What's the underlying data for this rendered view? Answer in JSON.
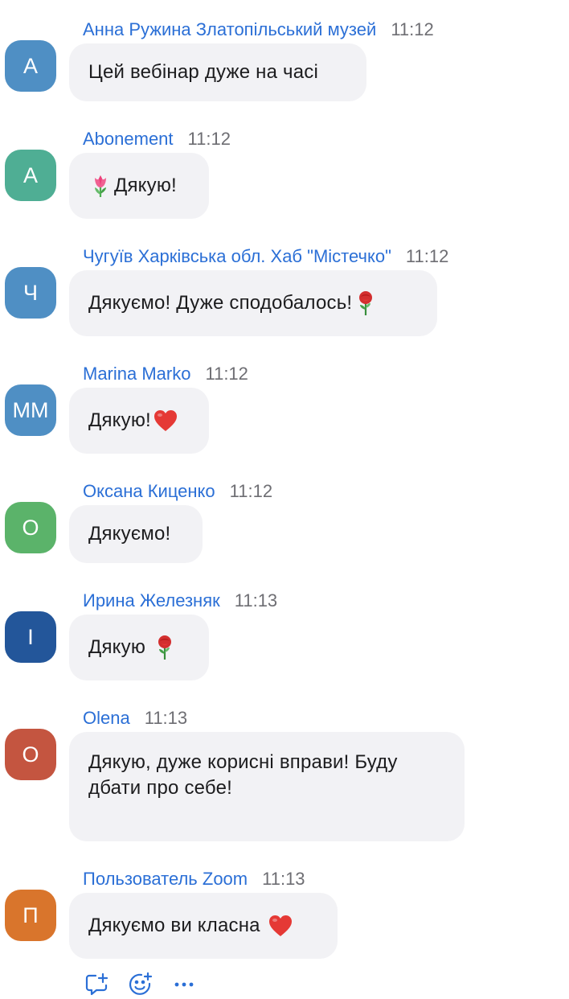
{
  "messages": [
    {
      "initials": "А",
      "avatar_color": "#4f8fc4",
      "sender": "Анна Ружина Златопільський музей",
      "time": "11:12",
      "text": "Цей вебінар дуже на часі",
      "emoji_before": "",
      "emoji_after": ""
    },
    {
      "initials": "А",
      "avatar_color": "#4fae94",
      "sender": "Abonement",
      "time": "11:12",
      "text": "Дякую!",
      "emoji_before": "tulip-emoji",
      "emoji_after": ""
    },
    {
      "initials": "Ч",
      "avatar_color": "#4f8fc4",
      "sender": "Чугуїв Харківська обл. Хаб \"Містечко\"",
      "time": "11:12",
      "text": "Дякуємо! Дуже сподобалось!",
      "emoji_before": "",
      "emoji_after": "rose-emoji"
    },
    {
      "initials": "MM",
      "avatar_color": "#4f8fc4",
      "sender": "Marina Marko",
      "time": "11:12",
      "text": "Дякую!",
      "emoji_before": "",
      "emoji_after": "heart-emoji"
    },
    {
      "initials": "О",
      "avatar_color": "#5bb36a",
      "sender": "Оксана Киценко",
      "time": "11:12",
      "text": "Дякуємо!",
      "emoji_before": "",
      "emoji_after": ""
    },
    {
      "initials": "І",
      "avatar_color": "#23569a",
      "sender": "Ирина Железняк",
      "time": "11:13",
      "text": "Дякую ",
      "emoji_before": "",
      "emoji_after": "rose-emoji"
    },
    {
      "initials": "О",
      "avatar_color": "#c45540",
      "sender": "Olena",
      "time": "11:13",
      "text": "Дякую, дуже корисні вправи! Буду дбати про себе!",
      "emoji_before": "",
      "emoji_after": ""
    },
    {
      "initials": "П",
      "avatar_color": "#d9752c",
      "sender": "Пользователь Zoom",
      "time": "11:13",
      "text": "Дякуємо ви класна ",
      "emoji_before": "",
      "emoji_after": "heart-emoji"
    }
  ],
  "toolbar": {
    "icons": [
      "reply-icon",
      "add-reaction-icon",
      "more-icon"
    ]
  }
}
